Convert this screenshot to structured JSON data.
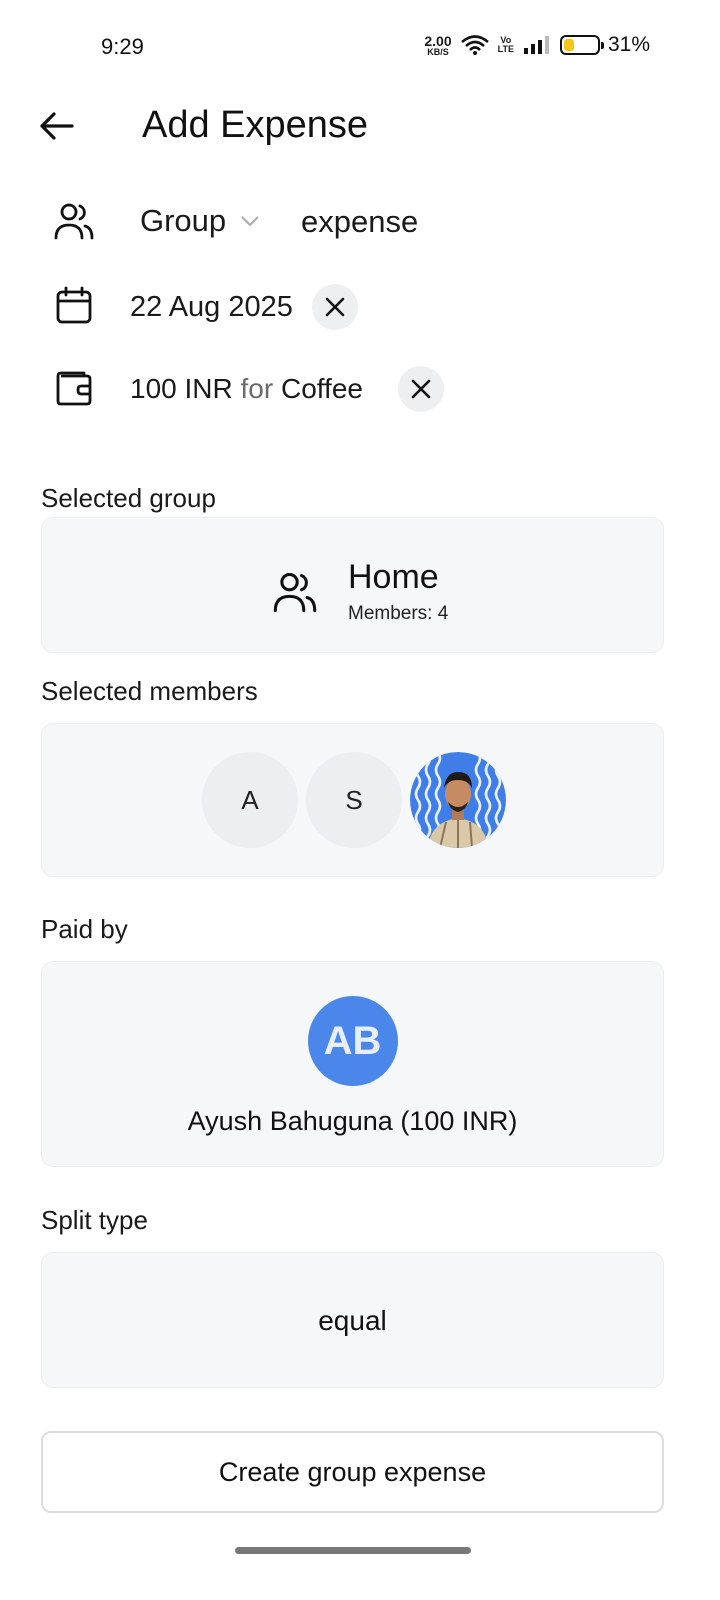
{
  "status_bar": {
    "time": "9:29",
    "net_speed": "2.00",
    "net_unit": "KB/S",
    "volte_top": "Vo",
    "volte_bottom": "LTE",
    "battery_percent": "31%",
    "battery_level": 0.31
  },
  "header": {
    "title": "Add Expense",
    "back_icon": "arrow-left-icon"
  },
  "group_row": {
    "icon": "users-icon",
    "group_label": "Group",
    "type_label": "expense"
  },
  "date_row": {
    "icon": "calendar-icon",
    "date": "22 Aug 2025",
    "clear_icon": "close-icon"
  },
  "amount_row": {
    "icon": "wallet-icon",
    "amount": "100 INR",
    "connector": "for",
    "description": "Coffee",
    "clear_icon": "close-icon"
  },
  "selected_group": {
    "label": "Selected group",
    "name": "Home",
    "members": "Members: 4"
  },
  "selected_members": {
    "label": "Selected members",
    "members": [
      {
        "initial": "A"
      },
      {
        "initial": "S"
      },
      {
        "type": "photo"
      }
    ]
  },
  "paid_by": {
    "label": "Paid by",
    "initials": "AB",
    "name": "Ayush Bahuguna (100 INR)"
  },
  "split_type": {
    "label": "Split type",
    "value": "equal"
  },
  "actions": {
    "create_label": "Create group expense"
  },
  "colors": {
    "card_bg": "#f6f7f9",
    "avatar_blue": "#4b86ea",
    "battery_fill": "#f5c518"
  }
}
